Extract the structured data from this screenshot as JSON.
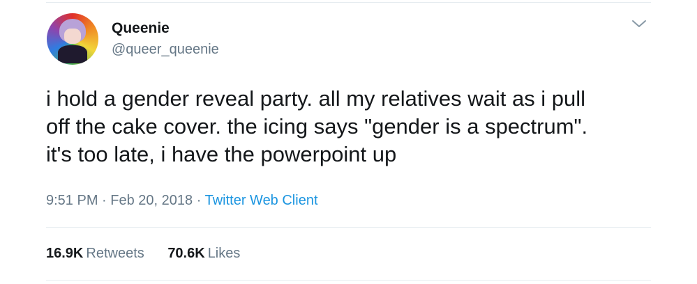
{
  "user": {
    "display_name": "Queenie",
    "handle": "@queer_queenie",
    "avatar_icon": "avatar-anime-character-rainbow-icon"
  },
  "tweet": {
    "lines": [
      "i hold a gender reveal party. all my relatives wait as i pull",
      "off the cake cover. the icing says \"gender is a spectrum\".",
      "it's too late, i have the powerpoint up"
    ]
  },
  "meta": {
    "time": "9:51 PM",
    "separator": "·",
    "date": "Feb 20, 2018",
    "source": "Twitter Web Client"
  },
  "stats": {
    "retweets_count": "16.9K",
    "retweets_label": "Retweets",
    "likes_count": "70.6K",
    "likes_label": "Likes"
  },
  "icons": {
    "menu": "chevron-down-icon"
  },
  "colors": {
    "text_primary": "#14171a",
    "text_secondary": "#657786",
    "link": "#1b95e0",
    "divider": "#e6ecf0"
  }
}
